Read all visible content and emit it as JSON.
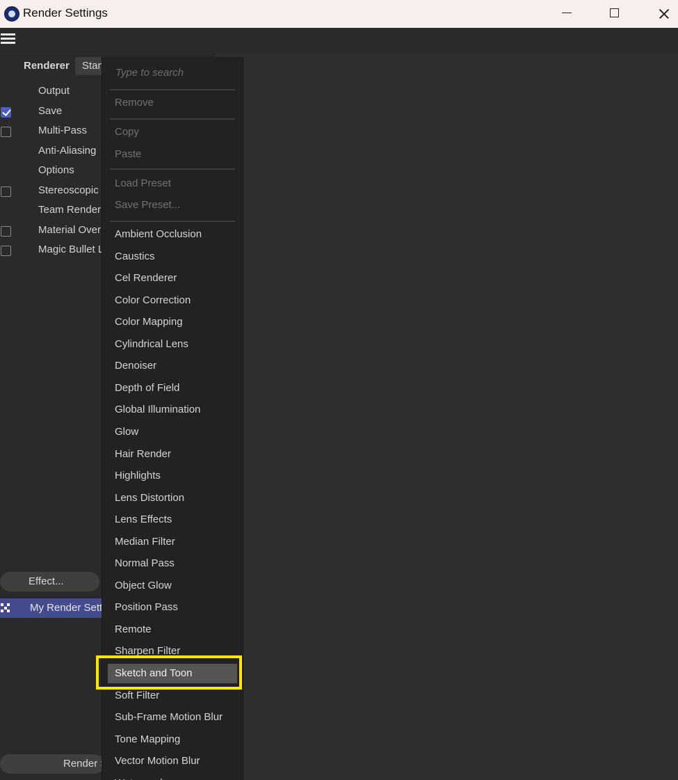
{
  "window": {
    "title": "Render Settings"
  },
  "left_panel": {
    "renderer_label": "Renderer",
    "renderer_value": "Standard",
    "items": [
      {
        "label": "Output",
        "checkbox": false,
        "checked": false
      },
      {
        "label": "Save",
        "checkbox": true,
        "checked": true
      },
      {
        "label": "Multi-Pass",
        "checkbox": true,
        "checked": false
      },
      {
        "label": "Anti-Aliasing",
        "checkbox": false,
        "checked": false
      },
      {
        "label": "Options",
        "checkbox": false,
        "checked": false
      },
      {
        "label": "Stereoscopic",
        "checkbox": true,
        "checked": false
      },
      {
        "label": "Team Render",
        "checkbox": false,
        "checked": false
      },
      {
        "label": "Material Override",
        "checkbox": true,
        "checked": false
      },
      {
        "label": "Magic Bullet Looks",
        "checkbox": true,
        "checked": false
      }
    ],
    "effect_button": "Effect...",
    "render_setting_name": "My Render Setting",
    "render_button": "Render Setting..."
  },
  "context_menu": {
    "search_placeholder": "Type to search",
    "items": [
      "Remove",
      "Copy",
      "Paste",
      "Load Preset",
      "Save Preset...",
      "Ambient Occlusion",
      "Caustics",
      "Cel Renderer",
      "Color Correction",
      "Color Mapping",
      "Cylindrical Lens",
      "Denoiser",
      "Depth of Field",
      "Global Illumination",
      "Glow",
      "Hair Render",
      "Highlights",
      "Lens Distortion",
      "Lens Effects",
      "Median Filter",
      "Normal Pass",
      "Object Glow",
      "Position Pass",
      "Remote",
      "Sharpen Filter",
      "Sketch and Toon",
      "Soft Filter",
      "Sub-Frame Motion Blur",
      "Tone Mapping",
      "Vector Motion Blur",
      "Watermark"
    ],
    "disabled_items": [
      "Remove",
      "Copy",
      "Paste",
      "Load Preset",
      "Save Preset..."
    ],
    "highlighted_item": "Sketch and Toon"
  },
  "colors": {
    "background": "#2f2f2f",
    "menu_background": "#222222",
    "selection_blue": "#444b8f",
    "checkbox_checked": "#4b5ebd",
    "annotation_yellow": "#ffe600"
  }
}
